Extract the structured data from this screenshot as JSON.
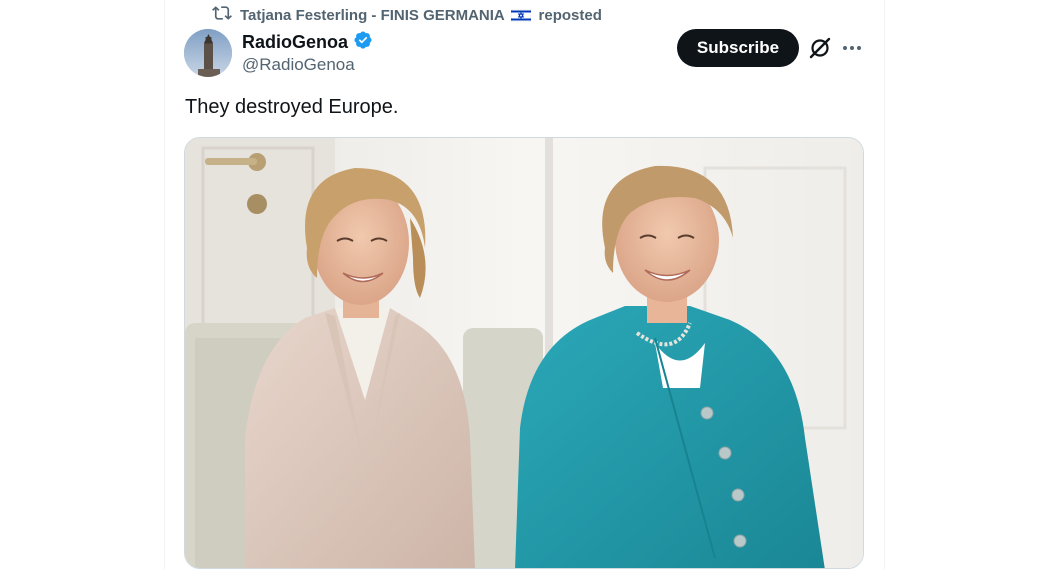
{
  "repost": {
    "text_before_flag": "Tatjana Festerling - FINIS GERMANIA",
    "text_after_flag": "reposted",
    "icon": "repost-icon",
    "flag_icon": "israel-flag-icon"
  },
  "author": {
    "display_name": "RadioGenoa",
    "handle": "@RadioGenoa",
    "verified_icon": "verified-badge-icon"
  },
  "actions": {
    "subscribe_label": "Subscribe",
    "grok_icon": "grok-icon",
    "more_icon": "more-options-icon"
  },
  "tweet": {
    "text": "They destroyed Europe."
  },
  "media": {
    "description_alt": "Photo of two smiling women seated in light armchairs; one in a beige blazer, one in a teal jacket with white shirt and pearl necklace."
  },
  "colors": {
    "accent": "#1d9bf0",
    "text_primary": "#0f1419",
    "text_secondary": "#536471",
    "button_bg": "#0f1419"
  }
}
